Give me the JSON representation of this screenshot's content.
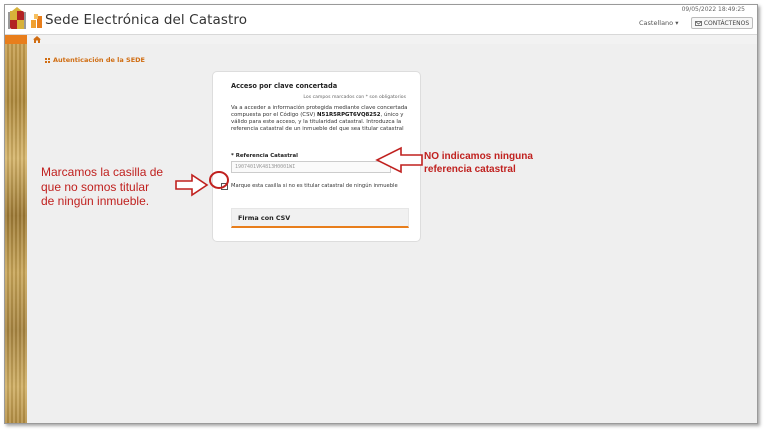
{
  "header": {
    "title": "Sede Electrónica del Catastro",
    "datetime": "09/05/2022 18:49:25",
    "language": "Castellano ▾",
    "contact_label": "CONTÁCTENOS"
  },
  "colors": {
    "accent": "#e87e1c",
    "annotation": "#c0211f"
  },
  "icons": [
    "crest-icon",
    "catastro-logo-icon",
    "home-icon",
    "grid-icon",
    "mail-icon",
    "arrow-icon"
  ],
  "page": {
    "section_title": "Autenticación de la SEDE"
  },
  "card": {
    "title": "Acceso por clave concertada",
    "required_note": "Los campos marcados con * son obligatorios",
    "text_pre": "Va a acceder a información protegida mediante clave concertada compuesta por el Código (CSV) ",
    "csv_code": "N51R5RPGT6VQ8252",
    "text_post": ", único y válido para este acceso, y la titularidad catastral. Introduzca la referencia catastral de un inmueble del que sea titular catastral",
    "ref_label": "* Referencia Catastral",
    "ref_placeholder": "1907401VK4813H0001WI",
    "checkbox_label": "Marque esta casilla si no es titular catastral de ningún inmueble",
    "checkbox_checked": true,
    "submit_label": "Firma con CSV"
  },
  "annotations": {
    "left_line1": "Marcamos la casilla de",
    "left_line2": "que no somos titular",
    "left_line3": "de ningún inmueble.",
    "right_line1": "NO indicamos ninguna",
    "right_line2": "referencia catastral"
  }
}
